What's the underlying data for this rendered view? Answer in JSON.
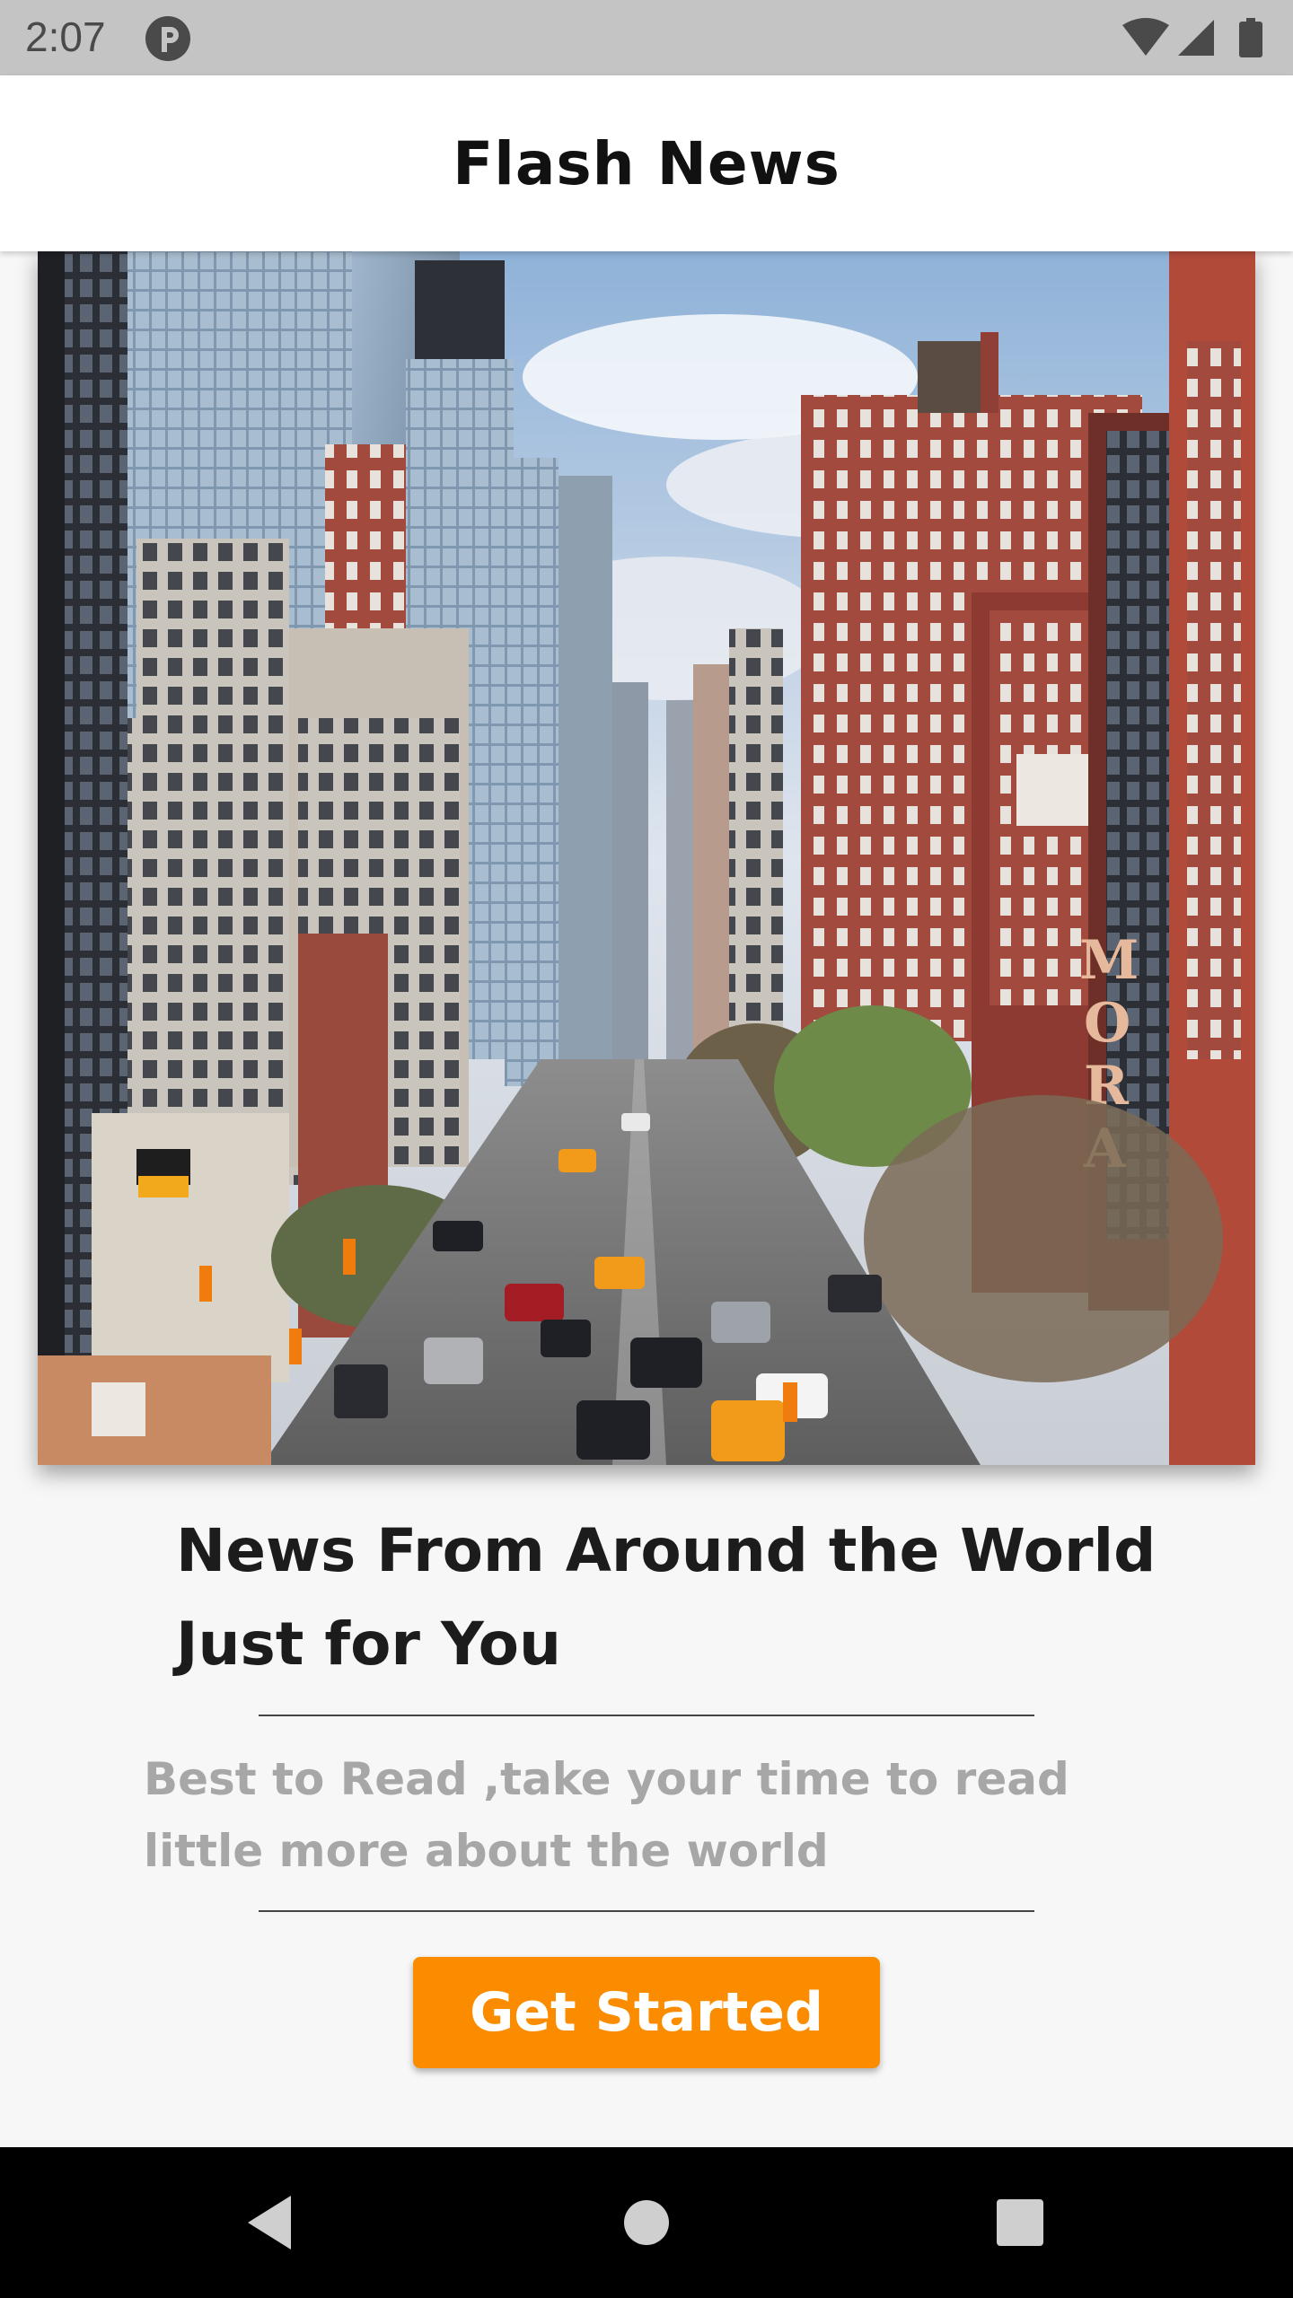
{
  "status_bar": {
    "time": "2:07",
    "icons": [
      "app-notification-icon",
      "wifi-icon",
      "cellular-signal-icon",
      "battery-icon"
    ]
  },
  "app_bar": {
    "title": "Flash News"
  },
  "hero": {
    "image": "city-street-photo"
  },
  "content": {
    "headline": "News From Around the World Just for You",
    "subtext": "Best to Read ,take your time to read little more about the world",
    "button_label": "Get Started"
  },
  "nav_bar": {
    "icons": [
      "back-icon",
      "home-icon",
      "recents-icon"
    ]
  },
  "colors": {
    "accent": "#fb8c00",
    "status_bar": "#c4c4c4",
    "app_bar": "#ffffff",
    "background": "#f7f7f7",
    "subtext": "#a7a7a7"
  }
}
